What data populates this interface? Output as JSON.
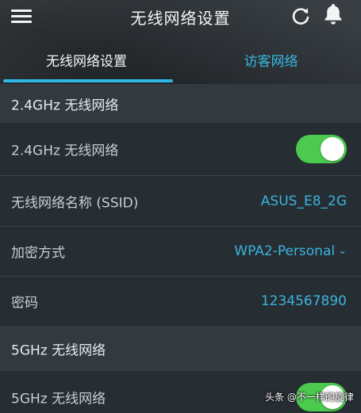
{
  "header": {
    "title": "无线网络设置",
    "menu_icon": "hamburger-menu-icon",
    "refresh_icon": "refresh-icon",
    "bell_icon": "notification-bell-icon"
  },
  "tabs": [
    {
      "label": "无线网络设置",
      "active": true
    },
    {
      "label": "访客网络",
      "active": false
    }
  ],
  "band_24": {
    "section_title": "2.4GHz 无线网络",
    "toggle_label": "2.4GHz 无线网络",
    "toggle_on": true,
    "ssid_label": "无线网络名称 (SSID)",
    "ssid_value": "ASUS_E8_2G",
    "encryption_label": "加密方式",
    "encryption_value": "WPA2-Personal",
    "password_label": "密码",
    "password_value": "1234567890"
  },
  "band_5": {
    "section_title": "5GHz 无线网络",
    "toggle_label": "5GHz 无线网络",
    "toggle_on": true
  },
  "watermark": "头条 @不一样的旋律",
  "colors": {
    "accent": "#36b9e2",
    "toggle_on": "#4cc94f"
  }
}
